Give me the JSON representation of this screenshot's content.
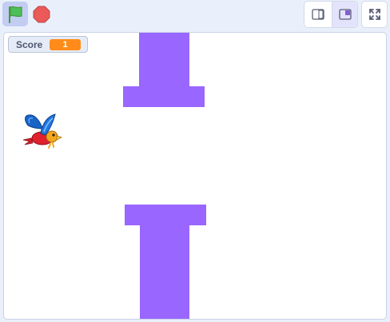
{
  "toolbar": {
    "green_flag": "green-flag-icon",
    "stop": "stop-sign-icon",
    "small_stage": "small-stage-icon",
    "normal_stage": "normal-stage-icon",
    "fullscreen": "fullscreen-icon"
  },
  "stage": {
    "score_monitor": {
      "label": "Score",
      "value": "1"
    },
    "sprite": "parrot-sprite",
    "obstacle_color": "#9966ff"
  },
  "colors": {
    "accent": "#9966ff",
    "monitor_value": "#ff8c1a",
    "flag": "#4cbf56",
    "stop": "#ec5959"
  }
}
